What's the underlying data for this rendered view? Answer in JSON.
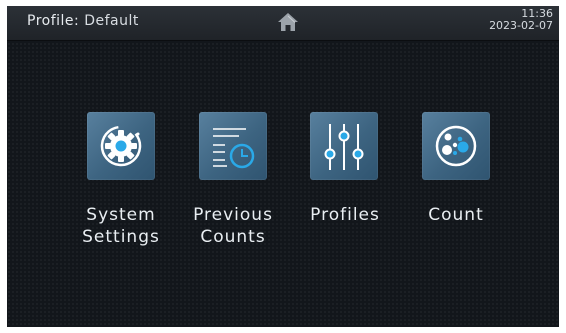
{
  "header": {
    "profile_label": "Profile:",
    "profile_value": "Default",
    "home_icon": "home-icon",
    "time": "11:36",
    "date": "2023-02-07"
  },
  "menu": [
    {
      "line1": "System",
      "line2": "Settings",
      "icon": "gear-icon"
    },
    {
      "line1": "Previous",
      "line2": "Counts",
      "icon": "history-list-icon"
    },
    {
      "line1": "Profiles",
      "line2": "",
      "icon": "sliders-icon"
    },
    {
      "line1": "Count",
      "line2": "",
      "icon": "cells-icon"
    }
  ],
  "colors": {
    "accent": "#2aa9e8",
    "tile": "#4a7393",
    "background": "#12161b"
  }
}
